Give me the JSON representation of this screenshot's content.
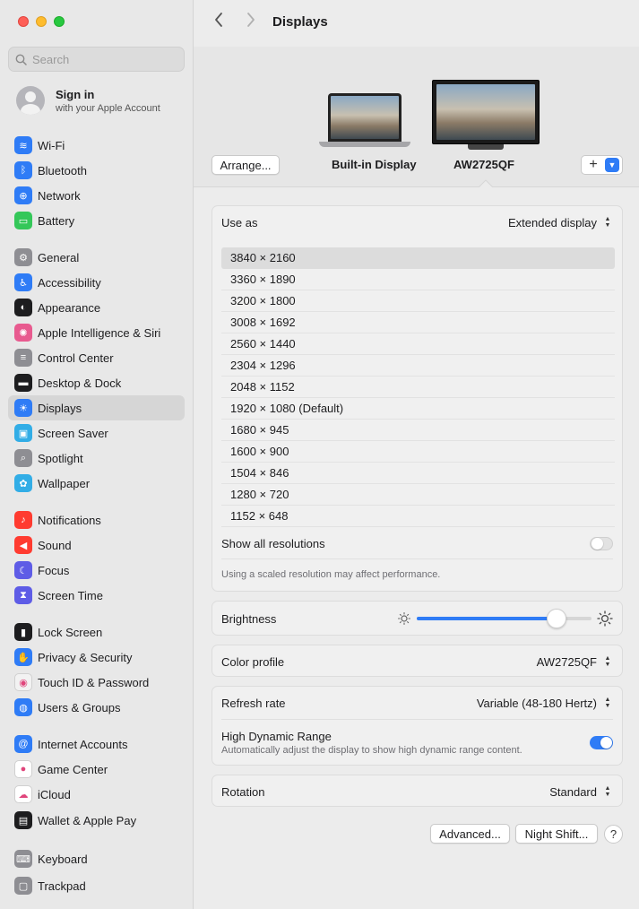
{
  "sidebar": {
    "search_placeholder": "Search",
    "account": {
      "name": "Sign in",
      "subtitle": "with your Apple Account"
    },
    "items": [
      {
        "label": "Wi-Fi",
        "icon": "wifi-icon",
        "color": "#2f7cf6"
      },
      {
        "label": "Bluetooth",
        "icon": "bluetooth-icon",
        "color": "#2f7cf6"
      },
      {
        "label": "Network",
        "icon": "globe-icon",
        "color": "#2f7cf6"
      },
      {
        "label": "Battery",
        "icon": "battery-icon",
        "color": "#34c759"
      },
      {
        "label": "General",
        "icon": "gear-icon",
        "color": "#8e8e93"
      },
      {
        "label": "Accessibility",
        "icon": "accessibility-icon",
        "color": "#2f7cf6"
      },
      {
        "label": "Appearance",
        "icon": "appearance-icon",
        "color": "#1d1d1f"
      },
      {
        "label": "Apple Intelligence & Siri",
        "icon": "siri-icon",
        "color": "#e85a8f"
      },
      {
        "label": "Control Center",
        "icon": "control-center-icon",
        "color": "#8e8e93"
      },
      {
        "label": "Desktop & Dock",
        "icon": "dock-icon",
        "color": "#1d1d1f"
      },
      {
        "label": "Displays",
        "icon": "sun-icon",
        "color": "#2f7cf6"
      },
      {
        "label": "Screen Saver",
        "icon": "screen-saver-icon",
        "color": "#32ade6"
      },
      {
        "label": "Spotlight",
        "icon": "magnifier-icon",
        "color": "#8e8e93"
      },
      {
        "label": "Wallpaper",
        "icon": "flower-icon",
        "color": "#32ade6"
      },
      {
        "label": "Notifications",
        "icon": "bell-icon",
        "color": "#ff3b30"
      },
      {
        "label": "Sound",
        "icon": "speaker-icon",
        "color": "#ff3b30"
      },
      {
        "label": "Focus",
        "icon": "moon-icon",
        "color": "#5e5ce6"
      },
      {
        "label": "Screen Time",
        "icon": "hourglass-icon",
        "color": "#5e5ce6"
      },
      {
        "label": "Lock Screen",
        "icon": "lock-icon",
        "color": "#1d1d1f"
      },
      {
        "label": "Privacy & Security",
        "icon": "hand-icon",
        "color": "#2f7cf6"
      },
      {
        "label": "Touch ID & Password",
        "icon": "fingerprint-icon",
        "color": "#f2f2f2"
      },
      {
        "label": "Users & Groups",
        "icon": "users-icon",
        "color": "#2f7cf6"
      },
      {
        "label": "Internet Accounts",
        "icon": "at-icon",
        "color": "#2f7cf6"
      },
      {
        "label": "Game Center",
        "icon": "game-center-icon",
        "color": "#ffffff"
      },
      {
        "label": "iCloud",
        "icon": "cloud-icon",
        "color": "#ffffff"
      },
      {
        "label": "Wallet & Apple Pay",
        "icon": "wallet-icon",
        "color": "#1d1d1f"
      },
      {
        "label": "Keyboard",
        "icon": "keyboard-icon",
        "color": "#8e8e93"
      },
      {
        "label": "Trackpad",
        "icon": "trackpad-icon",
        "color": "#8e8e93"
      }
    ],
    "active": "Displays"
  },
  "header": {
    "title": "Displays"
  },
  "displays": {
    "arrange_label": "Arrange...",
    "builtin_label": "Built-in Display",
    "external_label": "AW2725QF"
  },
  "use_as": {
    "label": "Use as",
    "value": "Extended display"
  },
  "resolutions": [
    "3840 × 2160",
    "3360 × 1890",
    "3200 × 1800",
    "3008 × 1692",
    "2560 × 1440",
    "2304 × 1296",
    "2048 × 1152",
    "1920 × 1080 (Default)",
    "1680 × 945",
    "1600 × 900",
    "1504 × 846",
    "1280 × 720",
    "1152 × 648"
  ],
  "selected_resolution": "3840 × 2160",
  "show_all": {
    "label": "Show all resolutions",
    "on": false
  },
  "scaled_hint": "Using a scaled resolution may affect performance.",
  "brightness": {
    "label": "Brightness",
    "level": 0.84
  },
  "color_profile": {
    "label": "Color profile",
    "value": "AW2725QF"
  },
  "refresh_rate": {
    "label": "Refresh rate",
    "value": "Variable (48-180 Hertz)"
  },
  "hdr": {
    "label": "High Dynamic Range",
    "description": "Automatically adjust the display to show high dynamic range content.",
    "on": true
  },
  "rotation": {
    "label": "Rotation",
    "value": "Standard"
  },
  "footer": {
    "advanced_label": "Advanced...",
    "night_shift_label": "Night Shift...",
    "help_label": "?"
  },
  "colors": {
    "accent": "#2f7cf6",
    "selection": "#dcdcdc"
  }
}
